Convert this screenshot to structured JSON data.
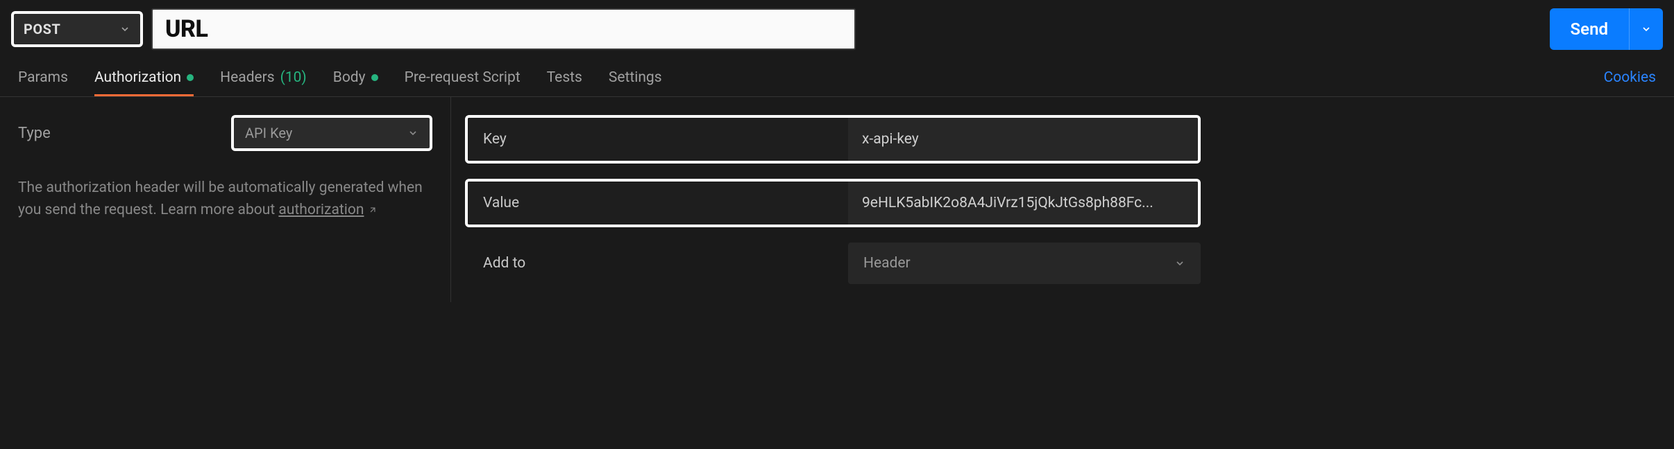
{
  "request": {
    "method": "POST",
    "url_placeholder": "URL",
    "url_value": ""
  },
  "send": {
    "label": "Send"
  },
  "tabs": {
    "params": "Params",
    "authorization": "Authorization",
    "headers": "Headers",
    "headers_count": "(10)",
    "body": "Body",
    "pre_request": "Pre-request Script",
    "tests": "Tests",
    "settings": "Settings"
  },
  "cookies": "Cookies",
  "auth": {
    "type_label": "Type",
    "type_value": "API Key",
    "help_text_1": "The authorization header will be automatically generated when you send the request. Learn more about ",
    "help_link": "authorization",
    "fields": {
      "key_label": "Key",
      "key_value": "x-api-key",
      "value_label": "Value",
      "value_value": "9eHLK5abIK2o8A4JiVrz15jQkJtGs8ph88Fc...",
      "addto_label": "Add to",
      "addto_value": "Header"
    }
  }
}
